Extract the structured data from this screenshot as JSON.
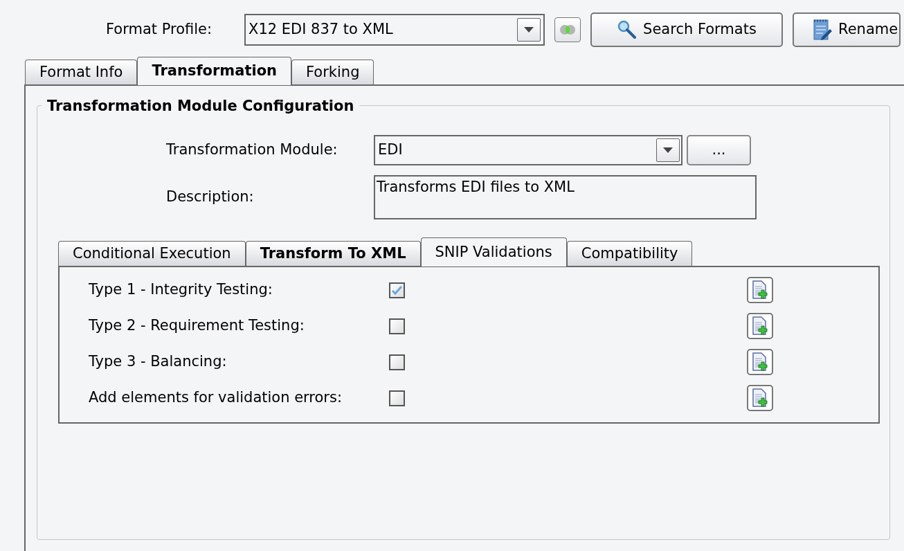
{
  "profile": {
    "label": "Format Profile:",
    "value": "X12 EDI 837 to XML"
  },
  "toolbar": [
    {
      "kind": "toggle"
    },
    {
      "kind": "search",
      "label": "Search Formats"
    },
    {
      "kind": "rename",
      "label": "Rename"
    }
  ],
  "tabs": [
    {
      "label": "Format Info",
      "selected": false
    },
    {
      "label": "Transformation",
      "selected": true
    },
    {
      "label": "Forking",
      "selected": false
    }
  ],
  "group": {
    "title": "Transformation Module Configuration",
    "module": {
      "label": "Transformation Module:",
      "value": "EDI",
      "button": "..."
    },
    "description": {
      "label": "Description:",
      "value": "Transforms EDI files to XML"
    },
    "subtabs": [
      {
        "label": "Conditional Execution",
        "selected": false,
        "bold": false
      },
      {
        "label": "Transform To XML",
        "selected": false,
        "bold": true
      },
      {
        "label": "SNIP Validations",
        "selected": true,
        "bold": false
      },
      {
        "label": "Compatibility",
        "selected": false,
        "bold": false
      }
    ],
    "rows": [
      {
        "label": "Type 1 - Integrity Testing:",
        "checked": true
      },
      {
        "label": "Type 2 - Requirement Testing:",
        "checked": false
      },
      {
        "label": "Type 3 - Balancing:",
        "checked": false
      },
      {
        "label": "Add elements for validation errors:",
        "checked": false
      }
    ]
  }
}
